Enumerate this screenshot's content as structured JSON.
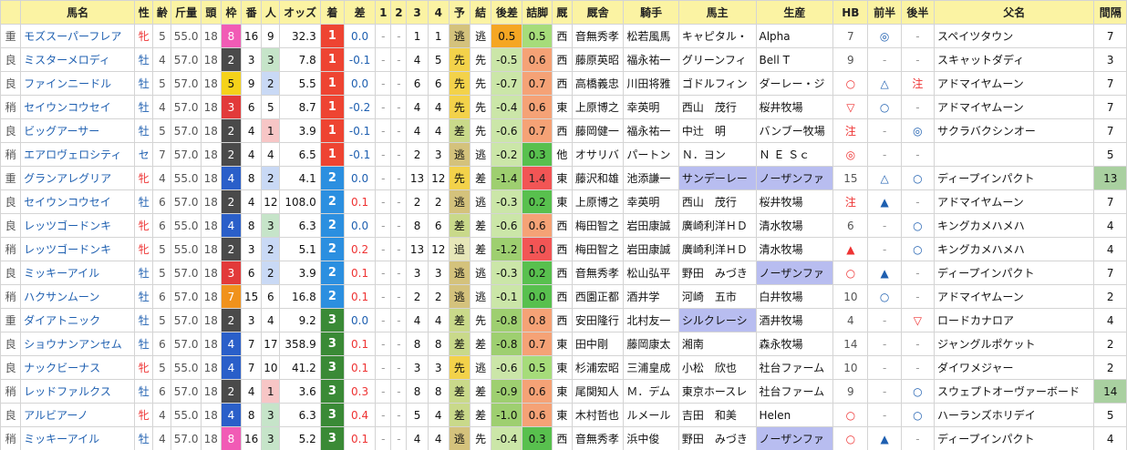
{
  "headers": [
    "馬名",
    "性",
    "齢",
    "斤量",
    "頭",
    "枠",
    "番",
    "人",
    "オッズ",
    "着",
    "差",
    "1",
    "2",
    "3",
    "4",
    "予",
    "結",
    "後差",
    "詰脚",
    "厩",
    "厩舎",
    "騎手",
    "馬主",
    "生産",
    "HB",
    "前半",
    "後半",
    "父名",
    "間隔"
  ],
  "rows": [
    {
      "cond": "重",
      "name": "モズスーパーフレア",
      "sex": "牝",
      "age": "5",
      "kin": "55.0",
      "tou": "18",
      "waku": "8",
      "ban": "16",
      "pop": "9",
      "odds": "32.3",
      "chaku": "1",
      "sa": "0.0",
      "c1": "-",
      "c2": "-",
      "c3": "1",
      "c4": "1",
      "yoso": "逃",
      "ketsu": "逃",
      "kosa": "0.5",
      "tsume": "0.5",
      "kyu": "西",
      "stable": "音無秀孝",
      "jockey": "松若風馬",
      "owner": "キャピタル・",
      "breeder": "Alpha",
      "hb": "7",
      "zen": "◎",
      "kou": "-",
      "sire": "スペイツタウン",
      "kan": "7"
    },
    {
      "cond": "良",
      "name": "ミスターメロディ",
      "sex": "牡",
      "age": "4",
      "kin": "57.0",
      "tou": "18",
      "waku": "2",
      "ban": "3",
      "pop": "3",
      "odds": "7.8",
      "chaku": "1",
      "sa": "-0.1",
      "c1": "-",
      "c2": "-",
      "c3": "4",
      "c4": "5",
      "yoso": "先",
      "ketsu": "先",
      "kosa": "-0.5",
      "tsume": "0.6",
      "kyu": "西",
      "stable": "藤原英昭",
      "jockey": "福永祐一",
      "owner": "グリーンフィ",
      "breeder": "Bell T",
      "hb": "9",
      "zen": "-",
      "kou": "-",
      "sire": "スキャットダディ",
      "kan": "3"
    },
    {
      "cond": "良",
      "name": "ファインニードル",
      "sex": "牡",
      "age": "5",
      "kin": "57.0",
      "tou": "18",
      "waku": "5",
      "ban": "9",
      "pop": "2",
      "odds": "5.5",
      "chaku": "1",
      "sa": "0.0",
      "c1": "-",
      "c2": "-",
      "c3": "6",
      "c4": "6",
      "yoso": "先",
      "ketsu": "先",
      "kosa": "-0.7",
      "tsume": "0.7",
      "kyu": "西",
      "stable": "高橋義忠",
      "jockey": "川田将雅",
      "owner": "ゴドルフィン",
      "breeder": "ダーレー・ジ",
      "hb": "○",
      "zen": "△",
      "kou": "注",
      "sire": "アドマイヤムーン",
      "kan": "7"
    },
    {
      "cond": "稍",
      "name": "セイウンコウセイ",
      "sex": "牡",
      "age": "4",
      "kin": "57.0",
      "tou": "18",
      "waku": "3",
      "ban": "6",
      "pop": "5",
      "odds": "8.7",
      "chaku": "1",
      "sa": "-0.2",
      "c1": "-",
      "c2": "-",
      "c3": "4",
      "c4": "4",
      "yoso": "先",
      "ketsu": "先",
      "kosa": "-0.4",
      "tsume": "0.6",
      "kyu": "東",
      "stable": "上原博之",
      "jockey": "幸英明",
      "owner": "西山　茂行",
      "breeder": "桜井牧場",
      "hb": "▽",
      "zen": "○",
      "kou": "-",
      "sire": "アドマイヤムーン",
      "kan": "7"
    },
    {
      "cond": "良",
      "name": "ビッグアーサー",
      "sex": "牡",
      "age": "5",
      "kin": "57.0",
      "tou": "18",
      "waku": "2",
      "ban": "4",
      "pop": "1",
      "odds": "3.9",
      "chaku": "1",
      "sa": "-0.1",
      "c1": "-",
      "c2": "-",
      "c3": "4",
      "c4": "4",
      "yoso": "差",
      "ketsu": "先",
      "kosa": "-0.6",
      "tsume": "0.7",
      "kyu": "西",
      "stable": "藤岡健一",
      "jockey": "福永祐一",
      "owner": "中辻　明",
      "breeder": "バンブー牧場",
      "hb": "注",
      "zen": "-",
      "kou": "◎",
      "sire": "サクラバクシンオー",
      "kan": "7"
    },
    {
      "cond": "稍",
      "name": "エアロヴェロシティ",
      "sex": "セ",
      "age": "7",
      "kin": "57.0",
      "tou": "18",
      "waku": "2",
      "ban": "4",
      "pop": "4",
      "odds": "6.5",
      "chaku": "1",
      "sa": "-0.1",
      "c1": "-",
      "c2": "-",
      "c3": "2",
      "c4": "3",
      "yoso": "逃",
      "ketsu": "逃",
      "kosa": "-0.2",
      "tsume": "0.3",
      "kyu": "他",
      "stable": "オサリバ",
      "jockey": "パートン",
      "owner": "Ｎ．ヨン",
      "breeder": "Ｎ Ｅ Ｓｃ",
      "hb": "◎",
      "zen": "-",
      "kou": "-",
      "sire": "",
      "kan": "5"
    },
    {
      "cond": "重",
      "name": "グランアレグリア",
      "sex": "牝",
      "age": "4",
      "kin": "55.0",
      "tou": "18",
      "waku": "4",
      "ban": "8",
      "pop": "2",
      "odds": "4.1",
      "chaku": "2",
      "sa": "0.0",
      "c1": "-",
      "c2": "-",
      "c3": "13",
      "c4": "12",
      "yoso": "先",
      "ketsu": "差",
      "kosa": "-1.4",
      "tsume": "1.4",
      "kyu": "東",
      "stable": "藤沢和雄",
      "jockey": "池添謙一",
      "owner": "サンデーレー",
      "breeder": "ノーザンファ",
      "hb": "15",
      "zen": "△",
      "kou": "○",
      "sire": "ディープインパクト",
      "kan": "13"
    },
    {
      "cond": "良",
      "name": "セイウンコウセイ",
      "sex": "牡",
      "age": "6",
      "kin": "57.0",
      "tou": "18",
      "waku": "2",
      "ban": "4",
      "pop": "12",
      "odds": "108.0",
      "chaku": "2",
      "sa": "0.1",
      "c1": "-",
      "c2": "-",
      "c3": "2",
      "c4": "2",
      "yoso": "逃",
      "ketsu": "逃",
      "kosa": "-0.3",
      "tsume": "0.2",
      "kyu": "東",
      "stable": "上原博之",
      "jockey": "幸英明",
      "owner": "西山　茂行",
      "breeder": "桜井牧場",
      "hb": "注",
      "zen": "▲",
      "kou": "-",
      "sire": "アドマイヤムーン",
      "kan": "7"
    },
    {
      "cond": "良",
      "name": "レッツゴードンキ",
      "sex": "牝",
      "age": "6",
      "kin": "55.0",
      "tou": "18",
      "waku": "4",
      "ban": "8",
      "pop": "3",
      "odds": "6.3",
      "chaku": "2",
      "sa": "0.0",
      "c1": "-",
      "c2": "-",
      "c3": "8",
      "c4": "6",
      "yoso": "差",
      "ketsu": "差",
      "kosa": "-0.6",
      "tsume": "0.6",
      "kyu": "西",
      "stable": "梅田智之",
      "jockey": "岩田康誠",
      "owner": "廣崎利洋ＨＤ",
      "breeder": "清水牧場",
      "hb": "6",
      "zen": "-",
      "kou": "○",
      "sire": "キングカメハメハ",
      "kan": "4"
    },
    {
      "cond": "稍",
      "name": "レッツゴードンキ",
      "sex": "牝",
      "age": "5",
      "kin": "55.0",
      "tou": "18",
      "waku": "2",
      "ban": "3",
      "pop": "2",
      "odds": "5.1",
      "chaku": "2",
      "sa": "0.2",
      "c1": "-",
      "c2": "-",
      "c3": "13",
      "c4": "12",
      "yoso": "追",
      "ketsu": "差",
      "kosa": "-1.2",
      "tsume": "1.0",
      "kyu": "西",
      "stable": "梅田智之",
      "jockey": "岩田康誠",
      "owner": "廣崎利洋ＨＤ",
      "breeder": "清水牧場",
      "hb": "▲",
      "zen": "-",
      "kou": "○",
      "sire": "キングカメハメハ",
      "kan": "4"
    },
    {
      "cond": "良",
      "name": "ミッキーアイル",
      "sex": "牡",
      "age": "5",
      "kin": "57.0",
      "tou": "18",
      "waku": "3",
      "ban": "6",
      "pop": "2",
      "odds": "3.9",
      "chaku": "2",
      "sa": "0.1",
      "c1": "-",
      "c2": "-",
      "c3": "3",
      "c4": "3",
      "yoso": "逃",
      "ketsu": "逃",
      "kosa": "-0.3",
      "tsume": "0.2",
      "kyu": "西",
      "stable": "音無秀孝",
      "jockey": "松山弘平",
      "owner": "野田　みづき",
      "breeder": "ノーザンファ",
      "hb": "○",
      "zen": "▲",
      "kou": "-",
      "sire": "ディープインパクト",
      "kan": "7"
    },
    {
      "cond": "稍",
      "name": "ハクサンムーン",
      "sex": "牡",
      "age": "6",
      "kin": "57.0",
      "tou": "18",
      "waku": "7",
      "ban": "15",
      "pop": "6",
      "odds": "16.8",
      "chaku": "2",
      "sa": "0.1",
      "c1": "-",
      "c2": "-",
      "c3": "2",
      "c4": "2",
      "yoso": "逃",
      "ketsu": "逃",
      "kosa": "-0.1",
      "tsume": "0.0",
      "kyu": "西",
      "stable": "西園正都",
      "jockey": "酒井学",
      "owner": "河崎　五市",
      "breeder": "白井牧場",
      "hb": "10",
      "zen": "○",
      "kou": "-",
      "sire": "アドマイヤムーン",
      "kan": "2"
    },
    {
      "cond": "重",
      "name": "ダイアトニック",
      "sex": "牡",
      "age": "5",
      "kin": "57.0",
      "tou": "18",
      "waku": "2",
      "ban": "3",
      "pop": "4",
      "odds": "9.2",
      "chaku": "3",
      "sa": "0.0",
      "c1": "-",
      "c2": "-",
      "c3": "4",
      "c4": "4",
      "yoso": "差",
      "ketsu": "先",
      "kosa": "-0.8",
      "tsume": "0.8",
      "kyu": "西",
      "stable": "安田隆行",
      "jockey": "北村友一",
      "owner": "シルクレーシ",
      "breeder": "酒井牧場",
      "hb": "4",
      "zen": "-",
      "kou": "▽",
      "sire": "ロードカナロア",
      "kan": "4"
    },
    {
      "cond": "良",
      "name": "ショウナンアンセム",
      "sex": "牡",
      "age": "6",
      "kin": "57.0",
      "tou": "18",
      "waku": "4",
      "ban": "7",
      "pop": "17",
      "odds": "358.9",
      "chaku": "3",
      "sa": "0.1",
      "c1": "-",
      "c2": "-",
      "c3": "8",
      "c4": "8",
      "yoso": "差",
      "ketsu": "差",
      "kosa": "-0.8",
      "tsume": "0.7",
      "kyu": "東",
      "stable": "田中剛",
      "jockey": "藤岡康太",
      "owner": "湘南",
      "breeder": "森永牧場",
      "hb": "14",
      "zen": "-",
      "kou": "-",
      "sire": "ジャングルポケット",
      "kan": "2"
    },
    {
      "cond": "良",
      "name": "ナックビーナス",
      "sex": "牝",
      "age": "5",
      "kin": "55.0",
      "tou": "18",
      "waku": "4",
      "ban": "7",
      "pop": "10",
      "odds": "41.2",
      "chaku": "3",
      "sa": "0.1",
      "c1": "-",
      "c2": "-",
      "c3": "3",
      "c4": "3",
      "yoso": "先",
      "ketsu": "逃",
      "kosa": "-0.6",
      "tsume": "0.5",
      "kyu": "東",
      "stable": "杉浦宏昭",
      "jockey": "三浦皇成",
      "owner": "小松　欣也",
      "breeder": "社台ファーム",
      "hb": "10",
      "zen": "-",
      "kou": "-",
      "sire": "ダイワメジャー",
      "kan": "2"
    },
    {
      "cond": "稍",
      "name": "レッドファルクス",
      "sex": "牡",
      "age": "6",
      "kin": "57.0",
      "tou": "18",
      "waku": "2",
      "ban": "4",
      "pop": "1",
      "odds": "3.6",
      "chaku": "3",
      "sa": "0.3",
      "c1": "-",
      "c2": "-",
      "c3": "8",
      "c4": "8",
      "yoso": "差",
      "ketsu": "差",
      "kosa": "-0.9",
      "tsume": "0.6",
      "kyu": "東",
      "stable": "尾関知人",
      "jockey": "Ｍ．デム",
      "owner": "東京ホースレ",
      "breeder": "社台ファーム",
      "hb": "9",
      "zen": "-",
      "kou": "○",
      "sire": "スウェプトオーヴァーボード",
      "kan": "14"
    },
    {
      "cond": "良",
      "name": "アルビアーノ",
      "sex": "牝",
      "age": "4",
      "kin": "55.0",
      "tou": "18",
      "waku": "4",
      "ban": "8",
      "pop": "3",
      "odds": "6.3",
      "chaku": "3",
      "sa": "0.4",
      "c1": "-",
      "c2": "-",
      "c3": "5",
      "c4": "4",
      "yoso": "差",
      "ketsu": "差",
      "kosa": "-1.0",
      "tsume": "0.6",
      "kyu": "東",
      "stable": "木村哲也",
      "jockey": "ルメール",
      "owner": "吉田　和美",
      "breeder": "Helen",
      "hb": "○",
      "zen": "-",
      "kou": "○",
      "sire": "ハーランズホリデイ",
      "kan": "5"
    },
    {
      "cond": "稍",
      "name": "ミッキーアイル",
      "sex": "牡",
      "age": "4",
      "kin": "57.0",
      "tou": "18",
      "waku": "8",
      "ban": "16",
      "pop": "3",
      "odds": "5.2",
      "chaku": "3",
      "sa": "0.1",
      "c1": "-",
      "c2": "-",
      "c3": "4",
      "c4": "4",
      "yoso": "逃",
      "ketsu": "先",
      "kosa": "-0.4",
      "tsume": "0.3",
      "kyu": "西",
      "stable": "音無秀孝",
      "jockey": "浜中俊",
      "owner": "野田　みづき",
      "breeder": "ノーザンファ",
      "hb": "○",
      "zen": "▲",
      "kou": "-",
      "sire": "ディープインパクト",
      "kan": "4"
    }
  ]
}
